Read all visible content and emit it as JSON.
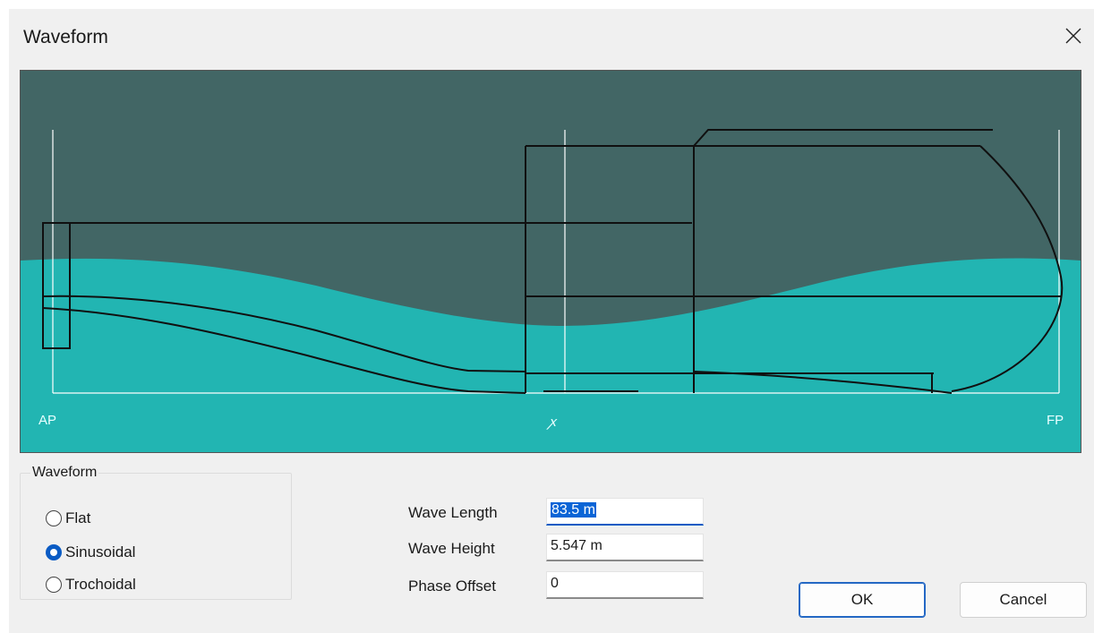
{
  "window": {
    "title": "Waveform"
  },
  "preview": {
    "labels": {
      "ap": "AP",
      "mid": "ꭗ",
      "fp": "FP"
    },
    "colors": {
      "sky": "#426665",
      "water": "#22b5b2",
      "hull_line": "#101010",
      "station_line": "#ffffff"
    }
  },
  "waveform_group": {
    "legend": "Waveform",
    "options": [
      {
        "label": "Flat",
        "checked": false
      },
      {
        "label": "Sinusoidal",
        "checked": true
      },
      {
        "label": "Trochoidal",
        "checked": false
      }
    ]
  },
  "fields": {
    "wave_length": {
      "label": "Wave Length",
      "value": "83.5 m"
    },
    "wave_height": {
      "label": "Wave Height",
      "value": "5.547 m"
    },
    "phase_offset": {
      "label": "Phase Offset",
      "value": "0"
    }
  },
  "buttons": {
    "ok": "OK",
    "cancel": "Cancel"
  },
  "accent_color": "#0a5bc4"
}
